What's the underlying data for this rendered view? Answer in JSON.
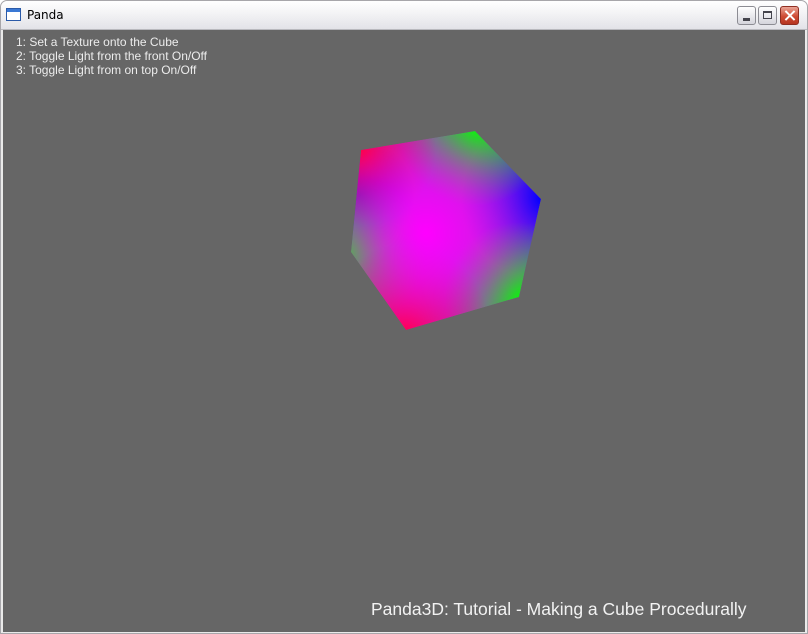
{
  "window": {
    "title": "Panda",
    "buttons": {
      "minimize": "minimize",
      "maximize": "maximize",
      "close": "close"
    }
  },
  "viewport": {
    "background_color": "#666666",
    "instructions": [
      "1: Set a Texture onto the Cube",
      "2: Toggle Light from the front On/Off",
      "3: Toggle Light from on top On/Off"
    ],
    "footer_title": "Panda3D: Tutorial - Making a Cube Procedurally"
  },
  "cube": {
    "vertex_colors": {
      "red": "#ff0033",
      "green": "#00ff00",
      "blue": "#0000ff",
      "magenta": "#ff00ff"
    }
  }
}
